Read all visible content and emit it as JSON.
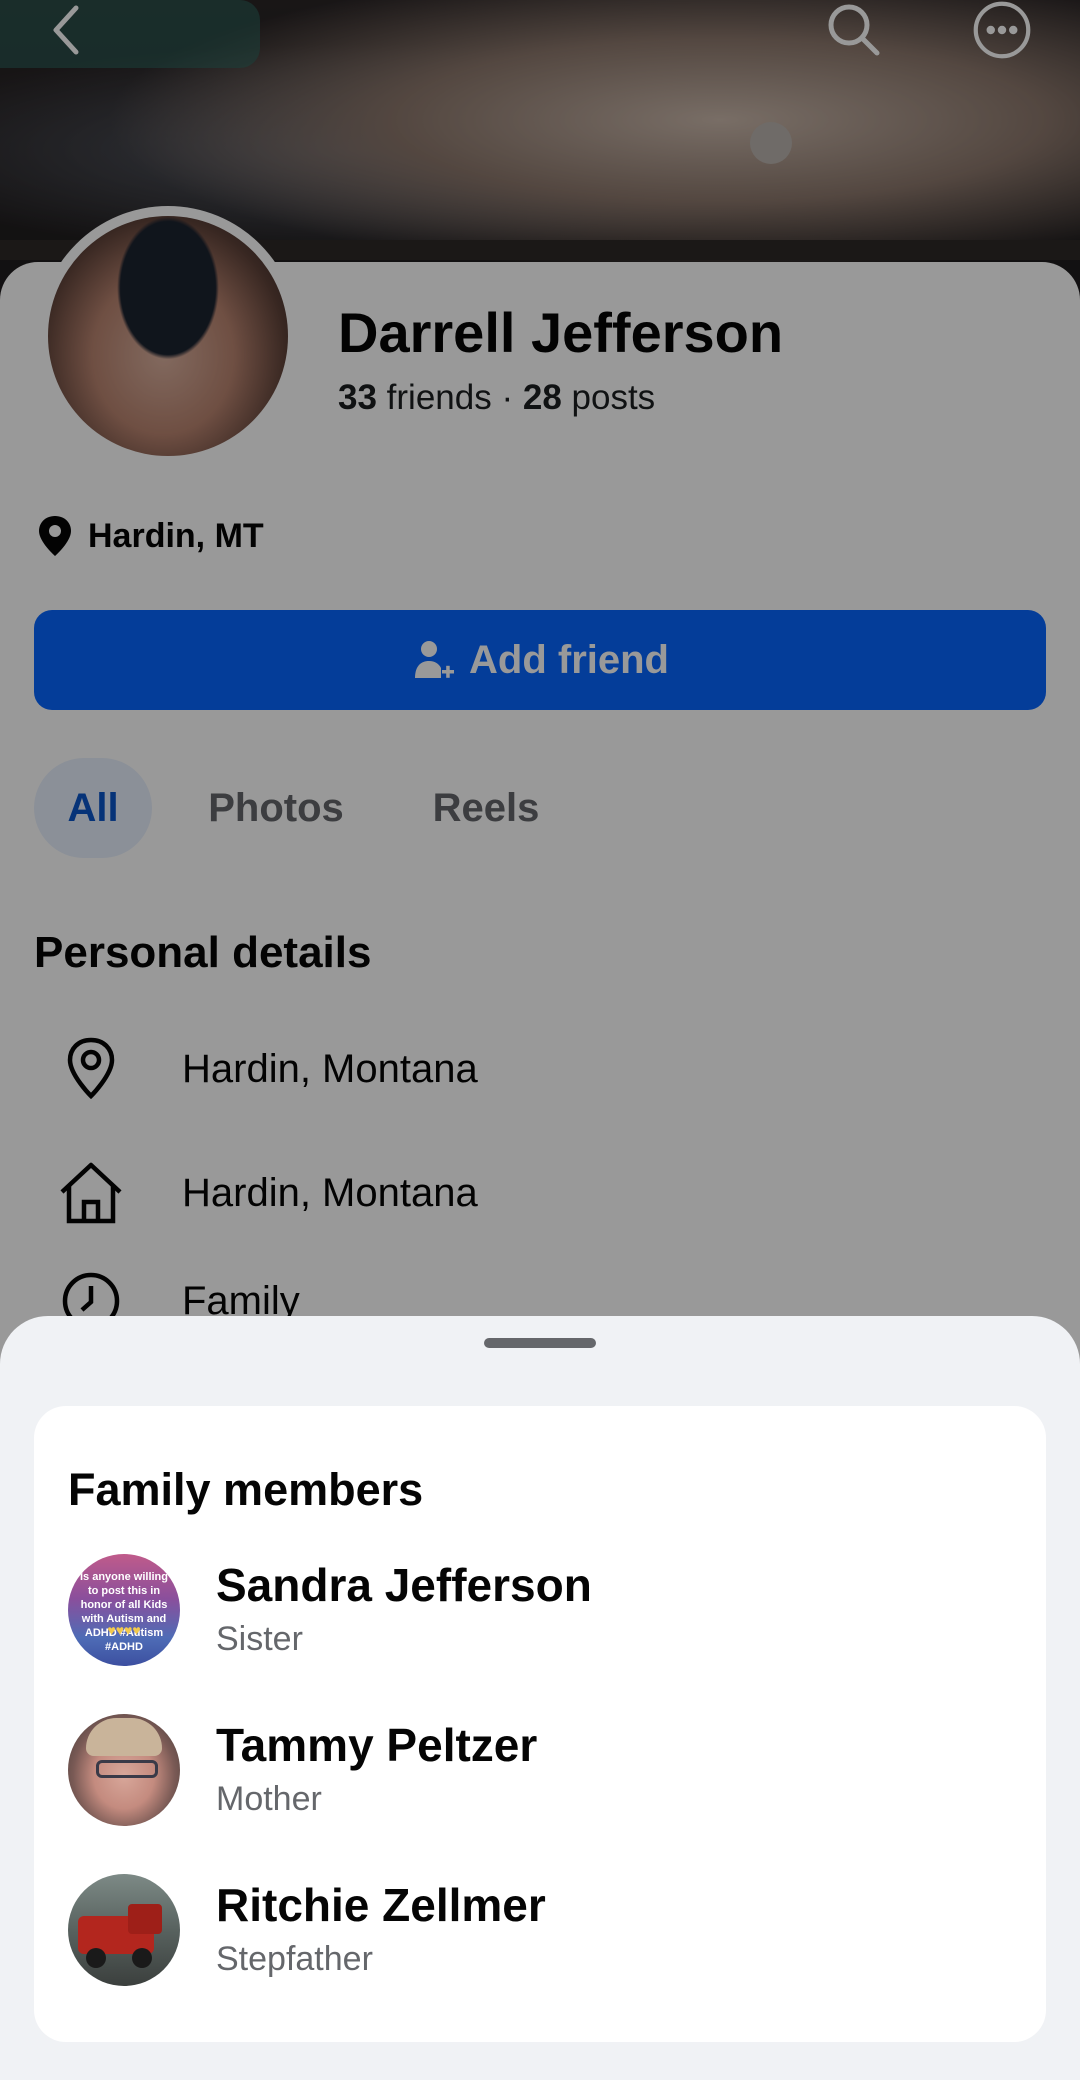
{
  "profile": {
    "name": "Darrell Jefferson",
    "friends_count": "33",
    "friends_label": "friends",
    "separator": "·",
    "posts_count": "28",
    "posts_label": "posts",
    "location_short": "Hardin, MT"
  },
  "actions": {
    "add_friend_label": "Add friend"
  },
  "tabs": [
    {
      "label": "All",
      "active": true
    },
    {
      "label": "Photos",
      "active": false
    },
    {
      "label": "Reels",
      "active": false
    }
  ],
  "personal_details": {
    "title": "Personal details",
    "items": [
      {
        "icon": "location-pin-icon",
        "text": "Hardin, Montana"
      },
      {
        "icon": "home-icon",
        "text": "Hardin, Montana"
      },
      {
        "icon": "relationship-icon",
        "text": "Family"
      }
    ]
  },
  "family_sheet": {
    "title": "Family members",
    "members": [
      {
        "name": "Sandra Jefferson",
        "relation": "Sister",
        "avatar_text": "Is anyone willing to post this in honor of all Kids with Autism and ADHD #Autism #ADHD"
      },
      {
        "name": "Tammy Peltzer",
        "relation": "Mother"
      },
      {
        "name": "Ritchie Zellmer",
        "relation": "Stepfather"
      }
    ]
  },
  "colors": {
    "brand_blue": "#0866ff",
    "tab_active_bg": "#e8f0fe",
    "tab_active_text": "#0a55c9",
    "sheet_bg": "#f0f2f5"
  }
}
